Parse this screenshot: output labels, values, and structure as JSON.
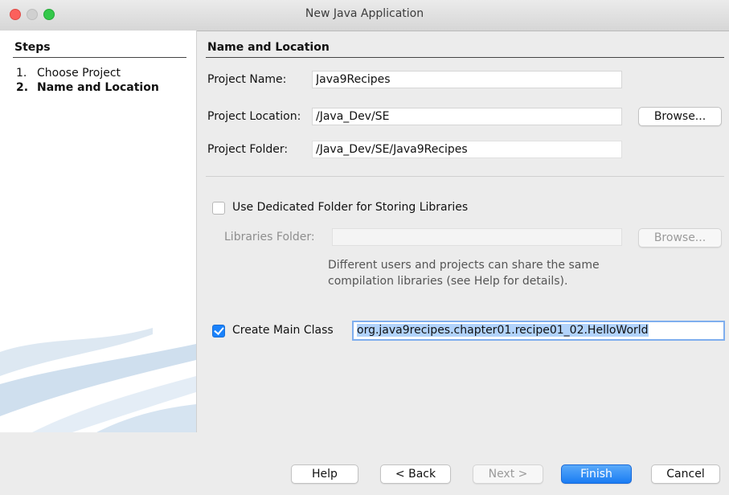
{
  "window": {
    "title": "New Java Application"
  },
  "steps": {
    "heading": "Steps",
    "items": [
      {
        "num": "1.",
        "label": "Choose Project"
      },
      {
        "num": "2.",
        "label": "Name and Location"
      }
    ]
  },
  "main": {
    "heading": "Name and Location",
    "project_name": {
      "label": "Project Name:",
      "value": "Java9Recipes"
    },
    "project_location": {
      "label": "Project Location:",
      "value": "/Java_Dev/SE",
      "browse": "Browse..."
    },
    "project_folder": {
      "label": "Project Folder:",
      "value": "/Java_Dev/SE/Java9Recipes"
    },
    "dedicated_folder": {
      "label": "Use Dedicated Folder for Storing Libraries",
      "checked": false
    },
    "libraries_folder": {
      "label": "Libraries Folder:",
      "value": "",
      "browse": "Browse..."
    },
    "help_text": {
      "line1": "Different users and projects can share the same",
      "line2": "compilation libraries (see Help for details)."
    },
    "create_main_class": {
      "label": "Create Main Class",
      "checked": true,
      "value": "org.java9recipes.chapter01.recipe01_02.HelloWorld"
    }
  },
  "buttons": {
    "help": "Help",
    "back": "< Back",
    "next": "Next >",
    "finish": "Finish",
    "cancel": "Cancel"
  },
  "colors": {
    "accent": "#1a82fb",
    "close": "#fc605c",
    "maximize": "#34c84a"
  }
}
